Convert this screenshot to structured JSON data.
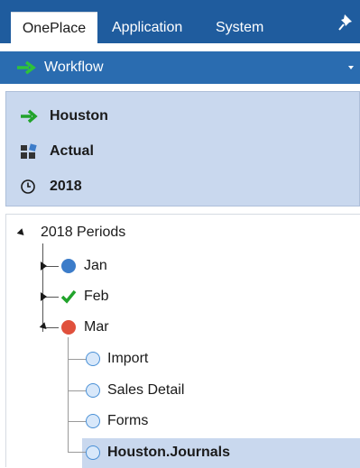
{
  "tabs": [
    {
      "label": "OnePlace",
      "active": true
    },
    {
      "label": "Application",
      "active": false
    },
    {
      "label": "System",
      "active": false
    }
  ],
  "pin_icon": "pin-icon",
  "workflow": {
    "label": "Workflow",
    "icon": "green-arrow-icon"
  },
  "pov": {
    "entity": {
      "label": "Houston",
      "icon": "green-arrow-icon"
    },
    "scenario": {
      "label": "Actual",
      "icon": "scenario-blocks-icon"
    },
    "time": {
      "label": "2018",
      "icon": "clock-icon"
    }
  },
  "tree": {
    "root": {
      "label": "2018 Periods",
      "expanded": true
    },
    "periods": [
      {
        "label": "Jan",
        "status": "blue-circle",
        "expanded": false
      },
      {
        "label": "Feb",
        "status": "green-check",
        "expanded": false
      },
      {
        "label": "Mar",
        "status": "red-circle",
        "expanded": true
      }
    ],
    "steps": [
      {
        "label": "Import",
        "selected": false
      },
      {
        "label": "Sales Detail",
        "selected": false
      },
      {
        "label": "Forms",
        "selected": false
      },
      {
        "label": "Houston.Journals",
        "selected": true
      }
    ]
  },
  "colors": {
    "tab_bar": "#1f5c9e",
    "workflow_bar": "#2a6cb0",
    "pov_panel": "#c9d8ee",
    "green": "#21a32b",
    "status_blue": "#3c7cc9",
    "status_red": "#e0503c"
  }
}
